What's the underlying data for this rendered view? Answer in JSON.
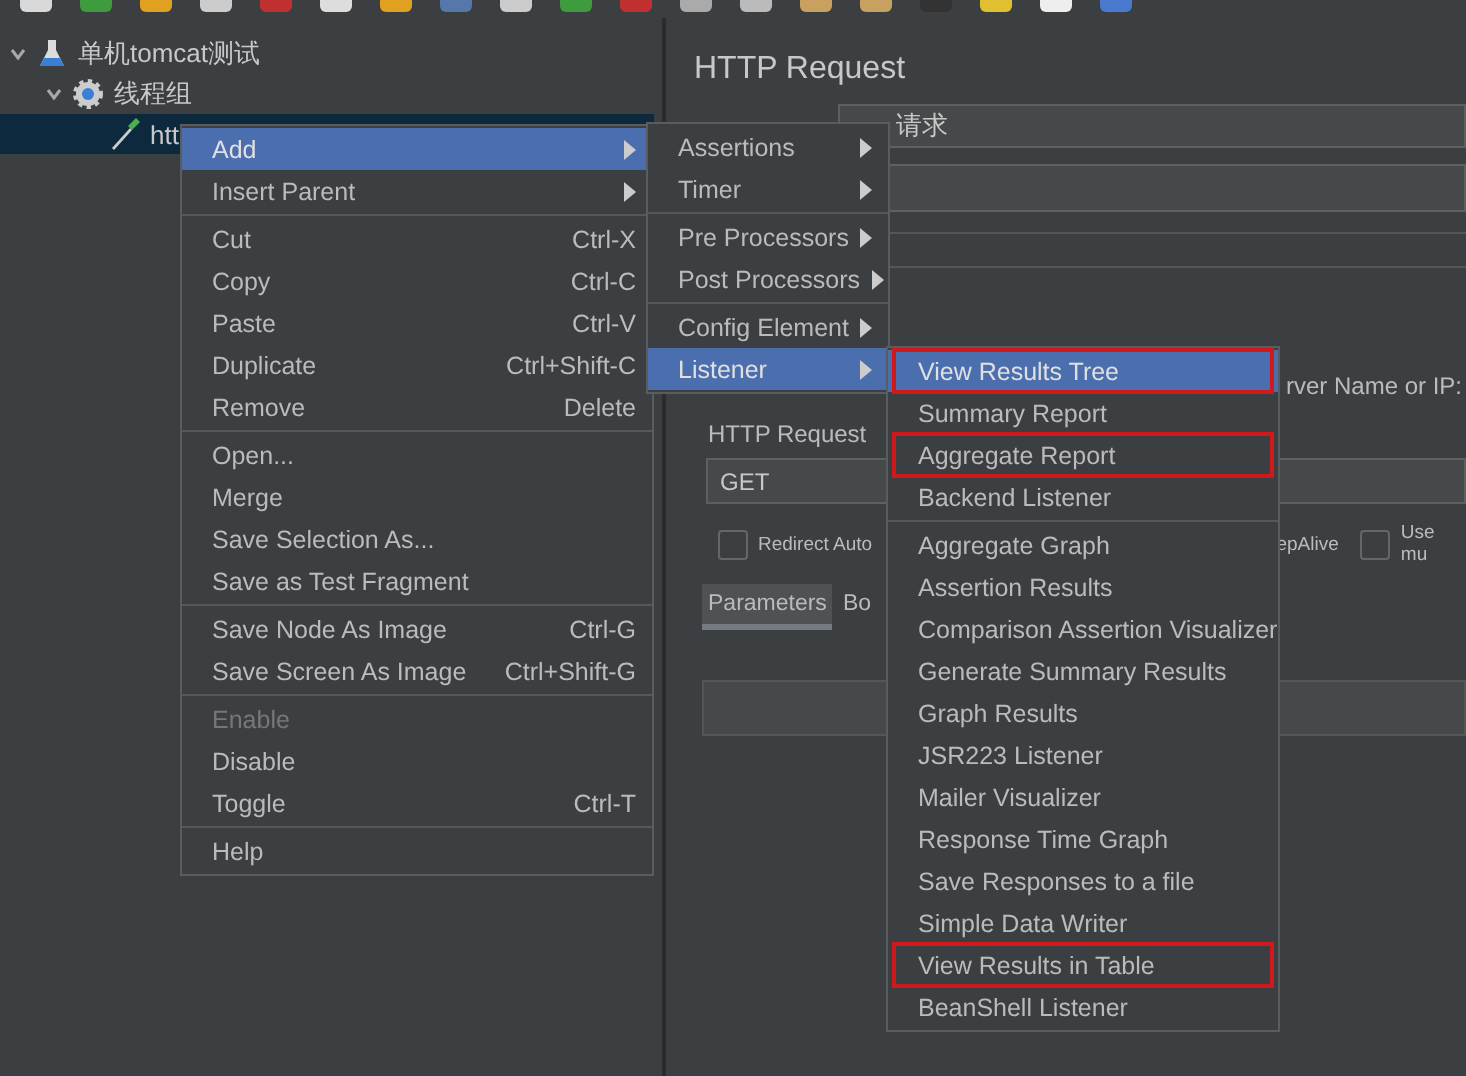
{
  "tree": [
    {
      "label": "单机tomcat测试",
      "kind": "test-plan",
      "expanded": true,
      "selected": false,
      "children": [
        {
          "label": "线程组",
          "kind": "thread-group",
          "expanded": true,
          "selected": false,
          "children": [
            {
              "label": "htt",
              "kind": "sampler",
              "selected": true
            }
          ]
        }
      ]
    }
  ],
  "editor": {
    "title": "HTTP Request",
    "name_value": "请求",
    "server_label": "rver Name or IP:",
    "method_label": "HTTP Request",
    "method_value": "GET",
    "options": [
      {
        "label": "Redirect Auto",
        "checked": false
      },
      {
        "label": "epAlive"
      },
      {
        "label": "Use mu",
        "checked": false
      }
    ],
    "tabs": [
      {
        "label": "Parameters",
        "selected": true
      },
      {
        "label": "Bo",
        "selected": false
      }
    ]
  },
  "context_menu": {
    "groups": [
      [
        {
          "label": "Add",
          "submenu": true,
          "selected": true,
          "disabled": false
        },
        {
          "label": "Insert Parent",
          "submenu": true,
          "selected": false,
          "disabled": false
        }
      ],
      [
        {
          "label": "Cut",
          "shortcut": "Ctrl-X",
          "submenu": false,
          "selected": false,
          "disabled": false
        },
        {
          "label": "Copy",
          "shortcut": "Ctrl-C",
          "submenu": false,
          "selected": false,
          "disabled": false
        },
        {
          "label": "Paste",
          "shortcut": "Ctrl-V",
          "submenu": false,
          "selected": false,
          "disabled": false
        },
        {
          "label": "Duplicate",
          "shortcut": "Ctrl+Shift-C",
          "submenu": false,
          "selected": false,
          "disabled": false
        },
        {
          "label": "Remove",
          "shortcut": "Delete",
          "submenu": false,
          "selected": false,
          "disabled": false
        }
      ],
      [
        {
          "label": "Open...",
          "submenu": false,
          "selected": false,
          "disabled": false
        },
        {
          "label": "Merge",
          "submenu": false,
          "selected": false,
          "disabled": false
        },
        {
          "label": "Save Selection As...",
          "submenu": false,
          "selected": false,
          "disabled": false
        },
        {
          "label": "Save as Test Fragment",
          "submenu": false,
          "selected": false,
          "disabled": false
        }
      ],
      [
        {
          "label": "Save Node As Image",
          "shortcut": "Ctrl-G",
          "submenu": false,
          "selected": false,
          "disabled": false
        },
        {
          "label": "Save Screen As Image",
          "shortcut": "Ctrl+Shift-G",
          "submenu": false,
          "selected": false,
          "disabled": false
        }
      ],
      [
        {
          "label": "Enable",
          "submenu": false,
          "selected": false,
          "disabled": true
        },
        {
          "label": "Disable",
          "submenu": false,
          "selected": false,
          "disabled": false
        },
        {
          "label": "Toggle",
          "shortcut": "Ctrl-T",
          "submenu": false,
          "selected": false,
          "disabled": false
        }
      ],
      [
        {
          "label": "Help",
          "submenu": false,
          "selected": false,
          "disabled": false
        }
      ]
    ]
  },
  "add_menu": {
    "groups": [
      [
        {
          "label": "Assertions",
          "selected": false
        },
        {
          "label": "Timer",
          "selected": false
        }
      ],
      [
        {
          "label": "Pre Processors",
          "selected": false
        },
        {
          "label": "Post Processors",
          "selected": false
        }
      ],
      [
        {
          "label": "Config Element",
          "selected": false
        },
        {
          "label": "Listener",
          "selected": true
        }
      ]
    ]
  },
  "listener_menu": {
    "groups": [
      [
        {
          "label": "View Results Tree",
          "selected": true,
          "annotated": true
        },
        {
          "label": "Summary Report",
          "selected": false,
          "annotated": false
        },
        {
          "label": "Aggregate Report",
          "selected": false,
          "annotated": true
        },
        {
          "label": "Backend Listener",
          "selected": false,
          "annotated": false
        }
      ],
      [
        {
          "label": "Aggregate Graph",
          "selected": false,
          "annotated": false
        },
        {
          "label": "Assertion Results",
          "selected": false,
          "annotated": false
        },
        {
          "label": "Comparison Assertion Visualizer",
          "selected": false,
          "annotated": false
        },
        {
          "label": "Generate Summary Results",
          "selected": false,
          "annotated": false
        },
        {
          "label": "Graph Results",
          "selected": false,
          "annotated": false
        },
        {
          "label": "JSR223 Listener",
          "selected": false,
          "annotated": false
        },
        {
          "label": "Mailer Visualizer",
          "selected": false,
          "annotated": false
        },
        {
          "label": "Response Time Graph",
          "selected": false,
          "annotated": false
        },
        {
          "label": "Save Responses to a file",
          "selected": false,
          "annotated": false
        },
        {
          "label": "Simple Data Writer",
          "selected": false,
          "annotated": false
        },
        {
          "label": "View Results in Table",
          "selected": false,
          "annotated": true
        },
        {
          "label": "BeanShell Listener",
          "selected": false,
          "annotated": false
        }
      ]
    ]
  }
}
